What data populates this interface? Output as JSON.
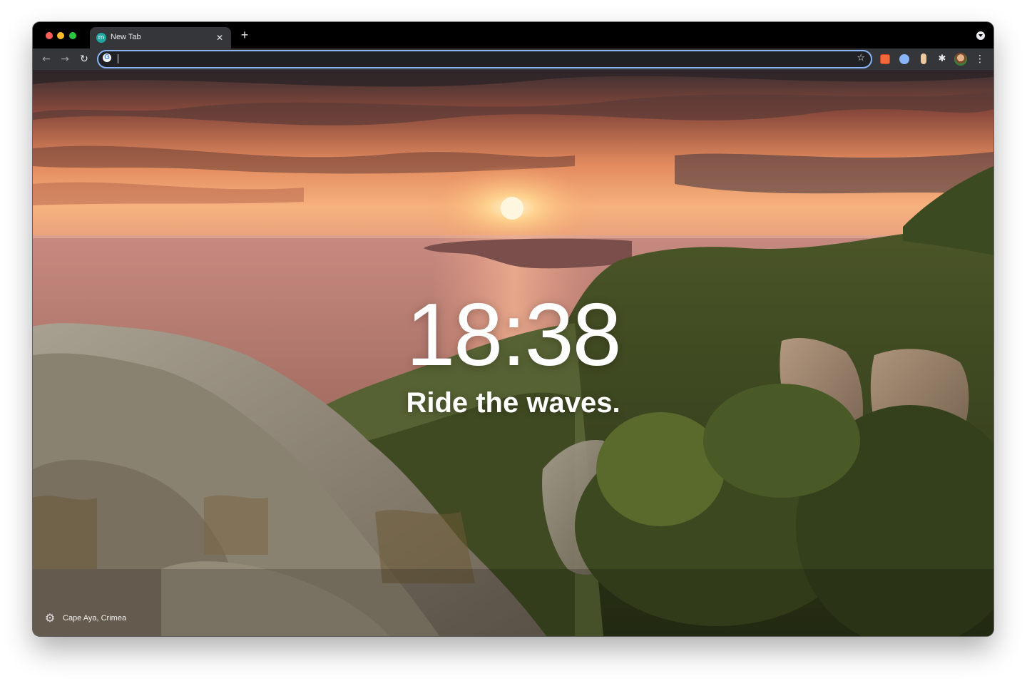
{
  "tab": {
    "title": "New Tab",
    "favicon_letter": "m",
    "close_glyph": "✕",
    "new_tab_glyph": "+"
  },
  "toolbar": {
    "back_glyph": "←",
    "forward_glyph": "→",
    "reload_glyph": "↻",
    "address_value": "",
    "google_glyph": "G",
    "bookmark_glyph": "☆",
    "extensions_glyph": "✱",
    "menu_glyph": "⋮"
  },
  "main": {
    "time": "18:38",
    "mantra": "Ride the waves."
  },
  "footer": {
    "settings_glyph": "⚙",
    "location": "Cape Aya, Crimea"
  },
  "colors": {
    "tabstrip": "#000000",
    "toolbar": "#35363a",
    "omnibox_focus": "#8ab4f8",
    "text": "#e8eaed",
    "sky_top": "#4a3a3a",
    "sun_glow": "#ffd9a0"
  },
  "icons": [
    "traffic-close",
    "traffic-minimize",
    "traffic-maximize",
    "tab-favicon",
    "close-icon",
    "plus-icon",
    "tab-search-icon",
    "back-arrow-icon",
    "forward-arrow-icon",
    "reload-icon",
    "google-icon",
    "star-icon",
    "extension-icon",
    "puzzle-icon",
    "avatar",
    "more-menu-icon",
    "gear-icon"
  ]
}
